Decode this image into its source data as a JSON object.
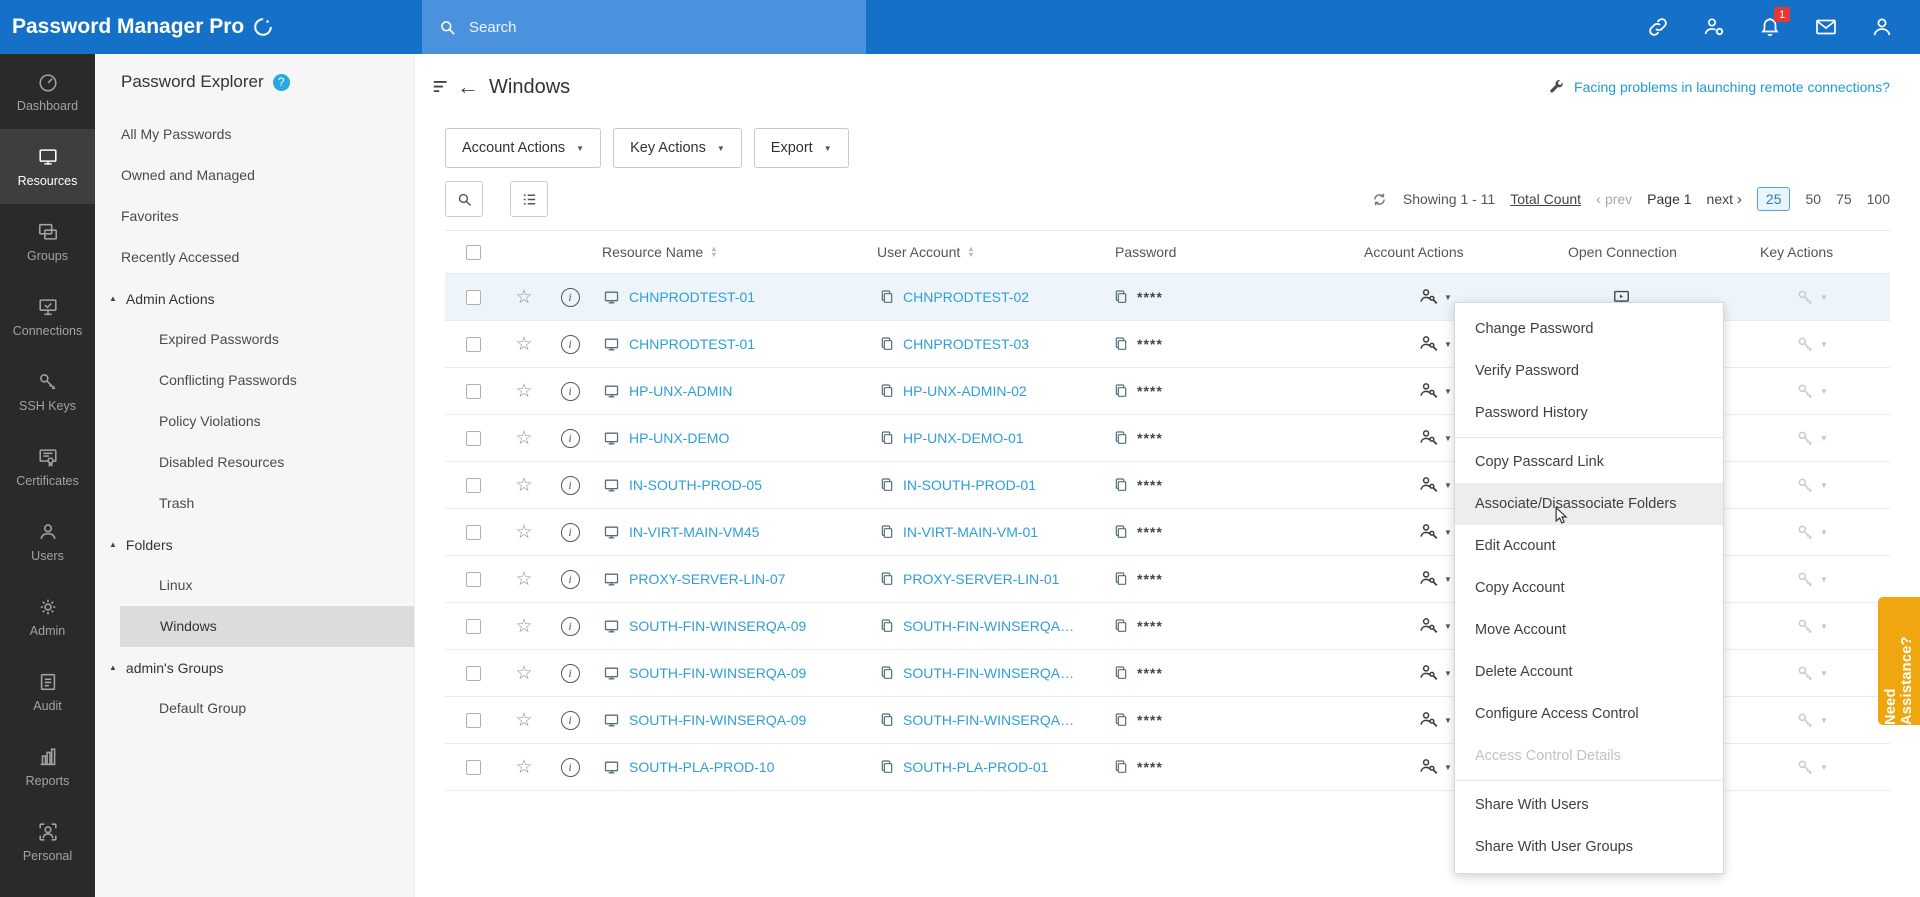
{
  "topbar": {
    "logo": "Password Manager Pro",
    "search_placeholder": "Search",
    "notification_count": "1"
  },
  "icons": {
    "help": "?",
    "info": "i",
    "star": "☆",
    "caret_down": "▼",
    "triangle_up": "▲",
    "back_arrow": "←",
    "prev_chevron": "‹",
    "next_chevron": "›",
    "sort_up": "▲",
    "sort_down": "▼"
  },
  "sidebar": {
    "items": [
      {
        "label": "Dashboard",
        "icon": "gauge-icon",
        "active": false
      },
      {
        "label": "Resources",
        "icon": "monitor-icon",
        "active": true
      },
      {
        "label": "Groups",
        "icon": "group-monitors-icon",
        "active": false
      },
      {
        "label": "Connections",
        "icon": "connection-icon",
        "active": false
      },
      {
        "label": "SSH Keys",
        "icon": "key-icon",
        "active": false
      },
      {
        "label": "Certificates",
        "icon": "certificate-icon",
        "active": false
      },
      {
        "label": "Users",
        "icon": "user-icon",
        "active": false
      },
      {
        "label": "Admin",
        "icon": "gear-icon",
        "active": false
      },
      {
        "label": "Audit",
        "icon": "audit-icon",
        "active": false
      },
      {
        "label": "Reports",
        "icon": "bar-chart-icon",
        "active": false
      },
      {
        "label": "Personal",
        "icon": "personal-icon",
        "active": false
      }
    ]
  },
  "explorer": {
    "title": "Password Explorer",
    "items": {
      "all": "All My Passwords",
      "owned": "Owned and Managed",
      "favorites": "Favorites",
      "recent": "Recently Accessed",
      "admin_actions": "Admin Actions",
      "expired": "Expired Passwords",
      "conflicting": "Conflicting Passwords",
      "policy": "Policy Violations",
      "disabled": "Disabled Resources",
      "trash": "Trash",
      "folders": "Folders",
      "linux": "Linux",
      "windows": "Windows",
      "admins_groups": "admin's Groups",
      "default_group": "Default Group"
    },
    "selected": "Windows"
  },
  "header": {
    "title": "Windows",
    "remote_link": "Facing problems in launching remote connections?"
  },
  "toolbar": {
    "account_actions": "Account Actions",
    "key_actions": "Key Actions",
    "export": "Export"
  },
  "pagination": {
    "showing": "Showing 1 - 11",
    "total_count_label": "Total Count",
    "prev_label": "prev",
    "page_label": "Page 1",
    "next_label": "next",
    "sizes": [
      "25",
      "50",
      "75",
      "100"
    ],
    "active_size": "25"
  },
  "table": {
    "headers": {
      "resource": "Resource Name",
      "user": "User Account",
      "password": "Password",
      "account_actions": "Account Actions",
      "open_connection": "Open Connection",
      "key_actions": "Key Actions"
    },
    "rows": [
      {
        "resource": "CHNPRODTEST-01",
        "user": "CHNPRODTEST-02",
        "password": "****",
        "selected": true
      },
      {
        "resource": "CHNPRODTEST-01",
        "user": "CHNPRODTEST-03",
        "password": "****",
        "selected": false
      },
      {
        "resource": "HP-UNX-ADMIN",
        "user": "HP-UNX-ADMIN-02",
        "password": "****",
        "selected": false
      },
      {
        "resource": "HP-UNX-DEMO",
        "user": "HP-UNX-DEMO-01",
        "password": "****",
        "selected": false
      },
      {
        "resource": "IN-SOUTH-PROD-05",
        "user": "IN-SOUTH-PROD-01",
        "password": "****",
        "selected": false
      },
      {
        "resource": "IN-VIRT-MAIN-VM45",
        "user": "IN-VIRT-MAIN-VM-01",
        "password": "****",
        "selected": false
      },
      {
        "resource": "PROXY-SERVER-LIN-07",
        "user": "PROXY-SERVER-LIN-01",
        "password": "****",
        "selected": false
      },
      {
        "resource": "SOUTH-FIN-WINSERQA-09",
        "user": "SOUTH-FIN-WINSERQA…",
        "password": "****",
        "selected": false
      },
      {
        "resource": "SOUTH-FIN-WINSERQA-09",
        "user": "SOUTH-FIN-WINSERQA…",
        "password": "****",
        "selected": false
      },
      {
        "resource": "SOUTH-FIN-WINSERQA-09",
        "user": "SOUTH-FIN-WINSERQA…",
        "password": "****",
        "selected": false
      },
      {
        "resource": "SOUTH-PLA-PROD-10",
        "user": "SOUTH-PLA-PROD-01",
        "password": "****",
        "selected": false
      }
    ]
  },
  "context_menu": {
    "items": [
      {
        "label": "Change Password"
      },
      {
        "label": "Verify Password"
      },
      {
        "label": "Password History"
      },
      {
        "label": "Copy Passcard Link",
        "divider_before": true
      },
      {
        "label": "Associate/Disassociate Folders",
        "highlighted": true
      },
      {
        "label": "Edit Account"
      },
      {
        "label": "Copy Account"
      },
      {
        "label": "Move Account"
      },
      {
        "label": "Delete Account"
      },
      {
        "label": "Configure Access Control"
      },
      {
        "label": "Access Control Details",
        "disabled": true
      },
      {
        "label": "Share With Users",
        "divider_before": true
      },
      {
        "label": "Share With User Groups"
      }
    ]
  },
  "need_assistance": "Need Assistance?"
}
